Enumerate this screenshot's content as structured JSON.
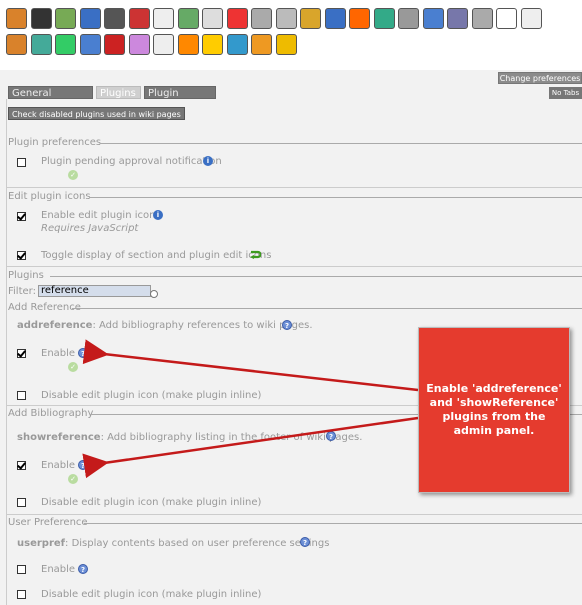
{
  "toolbar": {
    "icons": [
      "scissors-icon",
      "power-icon",
      "users-icon",
      "group-icon",
      "book-icon",
      "image-icon",
      "edit-icon",
      "puzzle-icon",
      "text-icon",
      "flag-icon",
      "document-icon",
      "timer-icon",
      "key-icon",
      "chat-icon",
      "rss-icon",
      "globe-icon",
      "paint-icon",
      "search-icon",
      "calculator-icon",
      "tag-icon",
      "font-icon",
      "list-icon",
      "book2-icon",
      "calendar-icon",
      "mail-icon",
      "chart-icon",
      "no-icon",
      "folder-icon",
      "form-icon",
      "cash-icon",
      "dollar-icon",
      "swap-icon",
      "refresh-icon",
      "bulb-icon"
    ]
  },
  "change_preferences": "Change preferences",
  "tabs": [
    "General Settings",
    "Plugins",
    "Plugin Aliases"
  ],
  "no_tabs": "No Tabs",
  "check_disabled": "Check disabled plugins used in wiki pages",
  "sections": {
    "plugin_preferences": "Plugin preferences",
    "pending_label": "Plugin pending approval notification",
    "edit_plugin_icons": "Edit plugin icons",
    "enable_edit_icons": "Enable edit plugin icons",
    "requires_js": "Requires JavaScript",
    "toggle_display": "Toggle display of section and plugin edit icons",
    "plugins": "Plugins",
    "filter_label": "Filter:",
    "filter_value": "reference",
    "add_reference": "Add Reference",
    "addref_name": "addreference",
    "addref_desc": ": Add bibliography references to wiki pages.",
    "enable": "Enable",
    "disable_inline": "Disable edit plugin icon (make plugin inline)",
    "add_bibliography": "Add Bibliography",
    "showref_name": "showreference",
    "showref_desc": ": Add bibliography listing in the footer of wiki pages.",
    "user_preference": "User Preference",
    "userpref_name": "userpref",
    "userpref_desc": ": Display contents based on user preference settings",
    "enable2": "Enable",
    "disable_inline3": "Disable edit plugin icon (make plugin inline)"
  },
  "callout": "Enable 'addreference' and 'showReference' plugins from the admin panel.",
  "colors": {
    "callout_bg": "#e53b2e",
    "arrow": "#c41a1a"
  }
}
